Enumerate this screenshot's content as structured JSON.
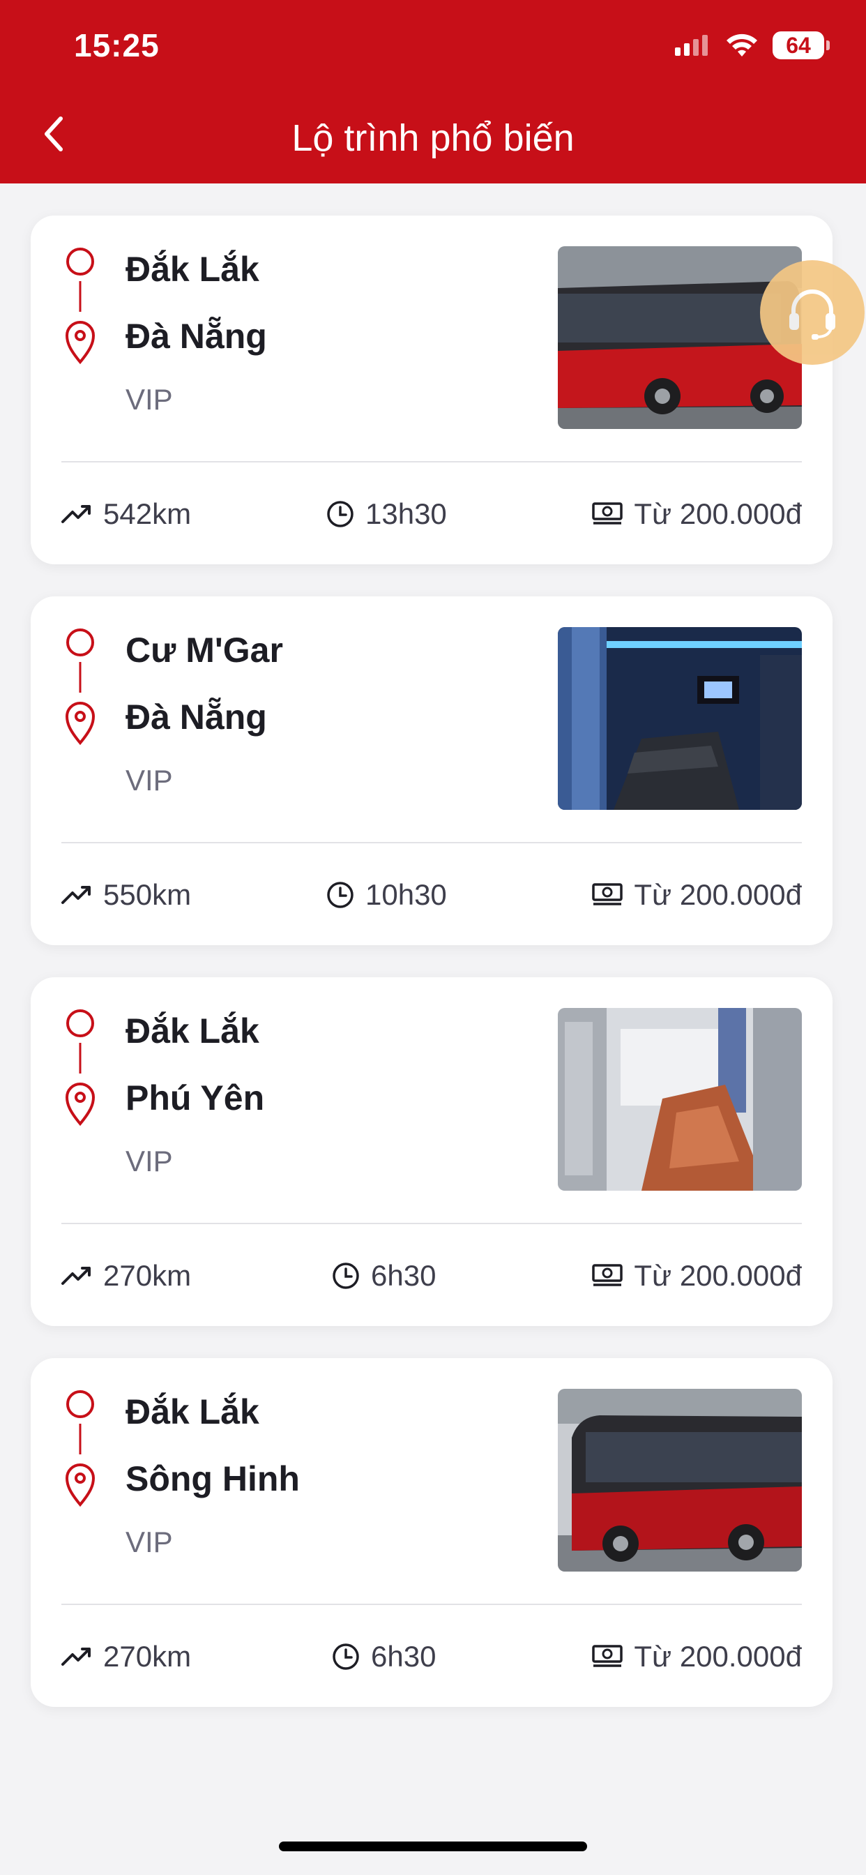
{
  "status_bar": {
    "time": "15:25",
    "battery": "64"
  },
  "header": {
    "title": "Lộ trình phổ biến",
    "back_icon": "chevron-left-icon"
  },
  "routes": [
    {
      "origin": "Đắk Lắk",
      "destination": "Đà Nẵng",
      "type": "VIP",
      "distance": "542km",
      "duration": "13h30",
      "price": "Từ 200.000đ",
      "image": "red-bus-exterior"
    },
    {
      "origin": "Cư M'Gar",
      "destination": "Đà Nẵng",
      "type": "VIP",
      "distance": "550km",
      "duration": "10h30",
      "price": "Từ 200.000đ",
      "image": "sleeper-bus-interior-blue"
    },
    {
      "origin": "Đắk Lắk",
      "destination": "Phú Yên",
      "type": "VIP",
      "distance": "270km",
      "duration": "6h30",
      "price": "Từ 200.000đ",
      "image": "sleeper-bus-interior-brown-seats"
    },
    {
      "origin": "Đắk Lắk",
      "destination": "Sông Hinh",
      "type": "VIP",
      "distance": "270km",
      "duration": "6h30",
      "price": "Từ 200.000đ",
      "image": "red-bus-exterior"
    }
  ],
  "support_button": {
    "icon": "headset-support-icon"
  },
  "colors": {
    "brand": "#c70f18",
    "support": "#f4c784",
    "text": "#1d1d24",
    "muted": "#6c6c7c"
  }
}
